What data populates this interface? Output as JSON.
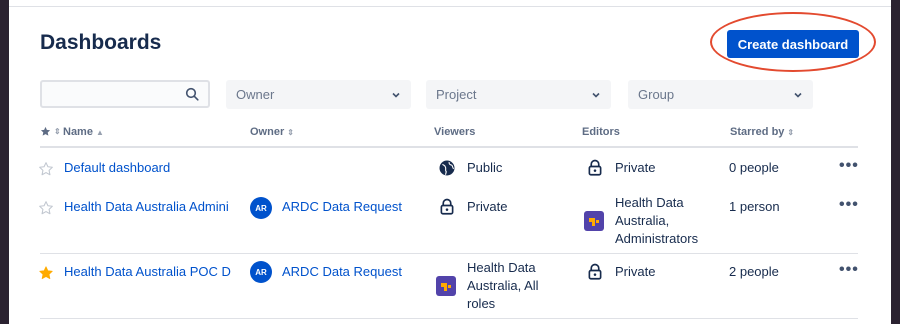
{
  "page": {
    "title": "Dashboards",
    "create_button": "Create dashboard"
  },
  "filters": {
    "search": {
      "value": "",
      "placeholder": ""
    },
    "owner": "Owner",
    "project": "Project",
    "group": "Group"
  },
  "columns": {
    "name": "Name",
    "owner": "Owner",
    "viewers": "Viewers",
    "editors": "Editors",
    "starred_by": "Starred by"
  },
  "rows": [
    {
      "starred": false,
      "name": "Default dashboard",
      "owner_initials": "",
      "owner": "",
      "viewers": "Public",
      "editors": "Private",
      "starred_by": "0 people"
    },
    {
      "starred": false,
      "name": "Health Data Australia Admini",
      "owner_initials": "AR",
      "owner": "ARDC Data Request",
      "viewers": "Private",
      "editors_lines": [
        "Health Data",
        "Australia,",
        "Administrators"
      ],
      "starred_by": "1 person"
    },
    {
      "starred": true,
      "name": "Health Data Australia POC D",
      "owner_initials": "AR",
      "owner": "ARDC Data Request",
      "viewers_lines": [
        "Health Data",
        "Australia, All",
        "roles"
      ],
      "editors": "Private",
      "starred_by": "2 people"
    }
  ],
  "more_actions": "•••",
  "colors": {
    "primary": "#0052cc",
    "annotation": "#e34a2f",
    "starred": "#ffab00",
    "group_icon": "#5243aa"
  }
}
